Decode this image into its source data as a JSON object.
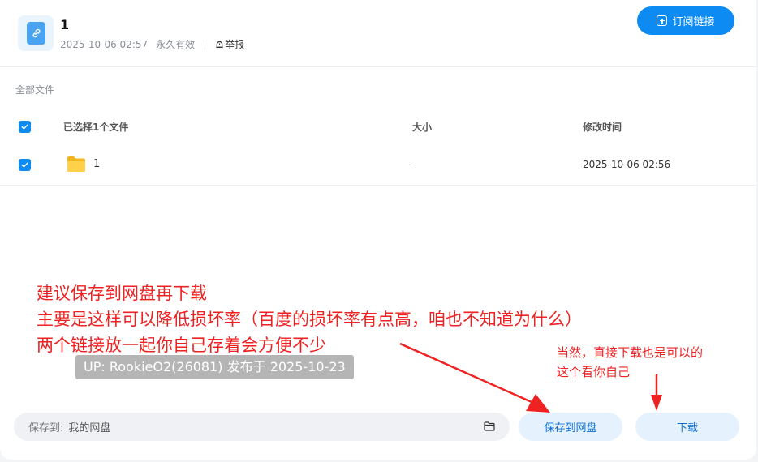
{
  "header": {
    "title": "1",
    "date": "2025-10-06 02:57",
    "validity": "永久有效",
    "report_label": "举报",
    "subscribe_label": "订阅链接"
  },
  "files": {
    "section_label": "全部文件",
    "header_selected": "已选择1个文件",
    "col_size": "大小",
    "col_modified": "修改时间",
    "rows": [
      {
        "name": "1",
        "size": "-",
        "modified": "2025-10-06 02:56",
        "checked": true
      }
    ]
  },
  "annotations": {
    "line1": "建议保存到网盘再下载",
    "line2": "主要是这样可以降低损坏率（百度的损坏率有点高，咱也不知道为什么）",
    "line3": "两个链接放一起你自己存着会方便不少",
    "small1": "当然，直接下载也是可以的",
    "small2": "这个看你自己",
    "up_badge": "UP: RookieO2(26081) 发布于 2025-10-23",
    "color": "#ee2222"
  },
  "footer": {
    "save_to_label": "保存到:",
    "save_to_value": "我的网盘",
    "save_button": "保存到网盘",
    "download_button": "下载"
  },
  "colors": {
    "accent": "#0d8bf2",
    "light_button": "#e5f2fd"
  }
}
